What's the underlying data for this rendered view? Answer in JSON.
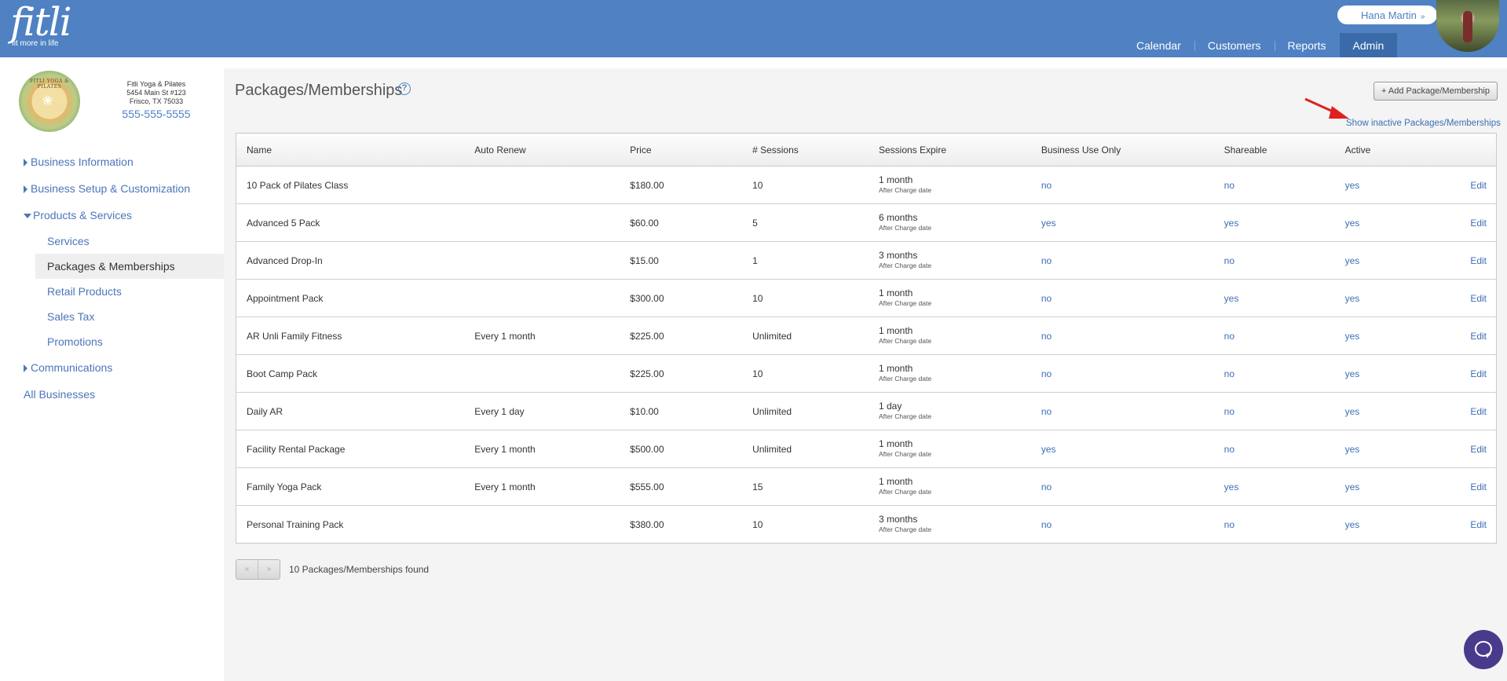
{
  "header": {
    "logo_word": "fitli",
    "logo_tagline": "fit more in life",
    "user_name": "Hana Martin",
    "user_chevron": "»",
    "nav": [
      {
        "label": "Calendar",
        "active": false
      },
      {
        "label": "Customers",
        "active": false
      },
      {
        "label": "Reports",
        "active": false
      },
      {
        "label": "Admin",
        "active": true
      }
    ],
    "brand_color": "#4f81c3"
  },
  "sidebar": {
    "logo_text": "FITLI YOGA & PILATES",
    "business_name": "Fitli Yoga & Pilates",
    "address_line1": "5454 Main St #123",
    "address_line2": "Frisco, TX 75033",
    "phone": "555-555-5555",
    "items": [
      {
        "label": "Business Information"
      },
      {
        "label": "Business Setup & Customization"
      },
      {
        "label": "Products & Services"
      },
      {
        "label": "Communications"
      }
    ],
    "sub_items": [
      {
        "label": "Services"
      },
      {
        "label": "Packages & Memberships"
      },
      {
        "label": "Retail Products"
      },
      {
        "label": "Sales Tax"
      },
      {
        "label": "Promotions"
      }
    ],
    "all_businesses": "All Businesses"
  },
  "main": {
    "title": "Packages/Memberships",
    "help_glyph": "?",
    "add_button": "+ Add Package/Membership",
    "show_inactive": "Show inactive Packages/Memberships",
    "columns": [
      "Name",
      "Auto Renew",
      "Price",
      "# Sessions",
      "Sessions Expire",
      "Business Use Only",
      "Shareable",
      "Active",
      ""
    ],
    "rows": [
      {
        "name": "10 Pack of Pilates Class",
        "auto_renew": "",
        "price": "$180.00",
        "sessions": "10",
        "expire": "1 month",
        "expire_note": "After Charge date",
        "business_use": "no",
        "shareable": "no",
        "active": "yes",
        "edit": "Edit"
      },
      {
        "name": "Advanced 5 Pack",
        "auto_renew": "",
        "price": "$60.00",
        "sessions": "5",
        "expire": "6 months",
        "expire_note": "After Charge date",
        "business_use": "yes",
        "shareable": "yes",
        "active": "yes",
        "edit": "Edit"
      },
      {
        "name": "Advanced Drop-In",
        "auto_renew": "",
        "price": "$15.00",
        "sessions": "1",
        "expire": "3 months",
        "expire_note": "After Charge date",
        "business_use": "no",
        "shareable": "no",
        "active": "yes",
        "edit": "Edit"
      },
      {
        "name": "Appointment Pack",
        "auto_renew": "",
        "price": "$300.00",
        "sessions": "10",
        "expire": "1 month",
        "expire_note": "After Charge date",
        "business_use": "no",
        "shareable": "yes",
        "active": "yes",
        "edit": "Edit"
      },
      {
        "name": "AR Unli Family Fitness",
        "auto_renew": "Every 1 month",
        "price": "$225.00",
        "sessions": "Unlimited",
        "expire": "1 month",
        "expire_note": "After Charge date",
        "business_use": "no",
        "shareable": "no",
        "active": "yes",
        "edit": "Edit"
      },
      {
        "name": "Boot Camp Pack",
        "auto_renew": "",
        "price": "$225.00",
        "sessions": "10",
        "expire": "1 month",
        "expire_note": "After Charge date",
        "business_use": "no",
        "shareable": "no",
        "active": "yes",
        "edit": "Edit"
      },
      {
        "name": "Daily AR",
        "auto_renew": "Every 1 day",
        "price": "$10.00",
        "sessions": "Unlimited",
        "expire": "1 day",
        "expire_note": "After Charge date",
        "business_use": "no",
        "shareable": "no",
        "active": "yes",
        "edit": "Edit"
      },
      {
        "name": "Facility Rental Package",
        "auto_renew": "Every 1 month",
        "price": "$500.00",
        "sessions": "Unlimited",
        "expire": "1 month",
        "expire_note": "After Charge date",
        "business_use": "yes",
        "shareable": "no",
        "active": "yes",
        "edit": "Edit"
      },
      {
        "name": "Family Yoga Pack",
        "auto_renew": "Every 1 month",
        "price": "$555.00",
        "sessions": "15",
        "expire": "1 month",
        "expire_note": "After Charge date",
        "business_use": "no",
        "shareable": "yes",
        "active": "yes",
        "edit": "Edit"
      },
      {
        "name": "Personal Training Pack",
        "auto_renew": "",
        "price": "$380.00",
        "sessions": "10",
        "expire": "3 months",
        "expire_note": "After Charge date",
        "business_use": "no",
        "shareable": "no",
        "active": "yes",
        "edit": "Edit"
      }
    ],
    "pager_prev": "«",
    "pager_next": "»",
    "found_text": "10 Packages/Memberships found"
  },
  "icons": {
    "help": "question-circle-icon",
    "arrow": "red-arrow-annotation-icon",
    "chat": "chat-bubble-icon",
    "caret_right": "caret-right-icon",
    "caret_down": "caret-down-icon"
  }
}
